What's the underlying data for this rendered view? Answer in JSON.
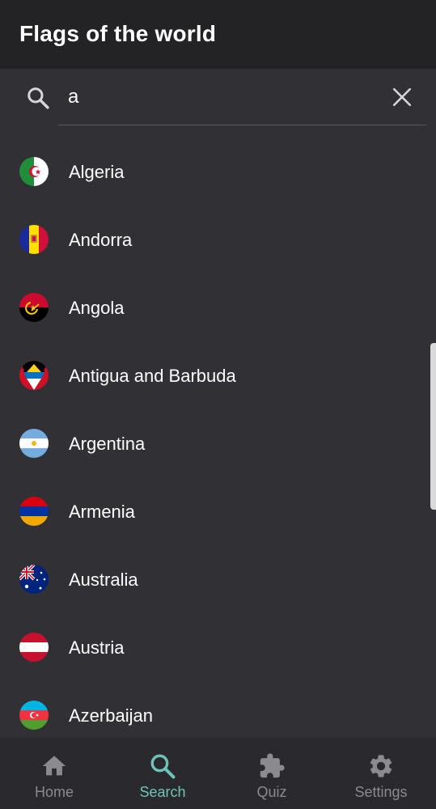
{
  "app": {
    "title": "Flags of the world"
  },
  "search": {
    "value": "a"
  },
  "countries": [
    {
      "name": "Algeria"
    },
    {
      "name": "Andorra"
    },
    {
      "name": "Angola"
    },
    {
      "name": "Antigua and Barbuda"
    },
    {
      "name": "Argentina"
    },
    {
      "name": "Armenia"
    },
    {
      "name": "Australia"
    },
    {
      "name": "Austria"
    },
    {
      "name": "Azerbaijan"
    }
  ],
  "nav": [
    {
      "label": "Home",
      "icon": "home-icon",
      "active": false
    },
    {
      "label": "Search",
      "icon": "search-icon",
      "active": true
    },
    {
      "label": "Quiz",
      "icon": "puzzle-icon",
      "active": false
    },
    {
      "label": "Settings",
      "icon": "gear-icon",
      "active": false
    }
  ],
  "colors": {
    "accent": "#6ec5b7",
    "background": "#313034",
    "appbar": "#232325"
  }
}
